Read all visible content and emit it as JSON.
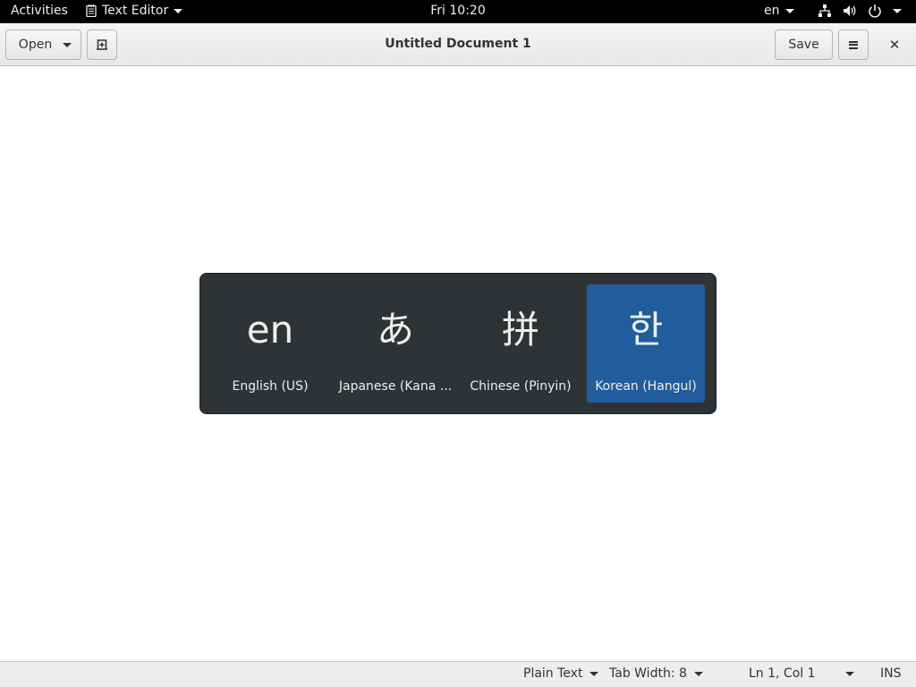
{
  "topbar": {
    "activities": "Activities",
    "app_name": "Text Editor",
    "clock": "Fri 10:20",
    "input_language": "en",
    "icons": [
      "notes-icon",
      "network-icon",
      "volume-icon",
      "power-icon"
    ]
  },
  "header": {
    "open_label": "Open",
    "title": "Untitled Document 1",
    "save_label": "Save"
  },
  "switcher": {
    "selected_index": 3,
    "sources": [
      {
        "glyph": "en",
        "label": "English (US)"
      },
      {
        "glyph": "あ",
        "label": "Japanese (Kana ..."
      },
      {
        "glyph": "拼",
        "label": "Chinese (Pinyin)"
      },
      {
        "glyph": "한",
        "label": "Korean (Hangul)"
      }
    ]
  },
  "statusbar": {
    "language": "Plain Text",
    "tab_width": "Tab Width: 8",
    "position": "Ln 1, Col 1",
    "mode": "INS"
  },
  "colors": {
    "topbar_bg": "#000000",
    "switcher_bg": "#2e3436",
    "selected_bg": "#215d9c"
  }
}
